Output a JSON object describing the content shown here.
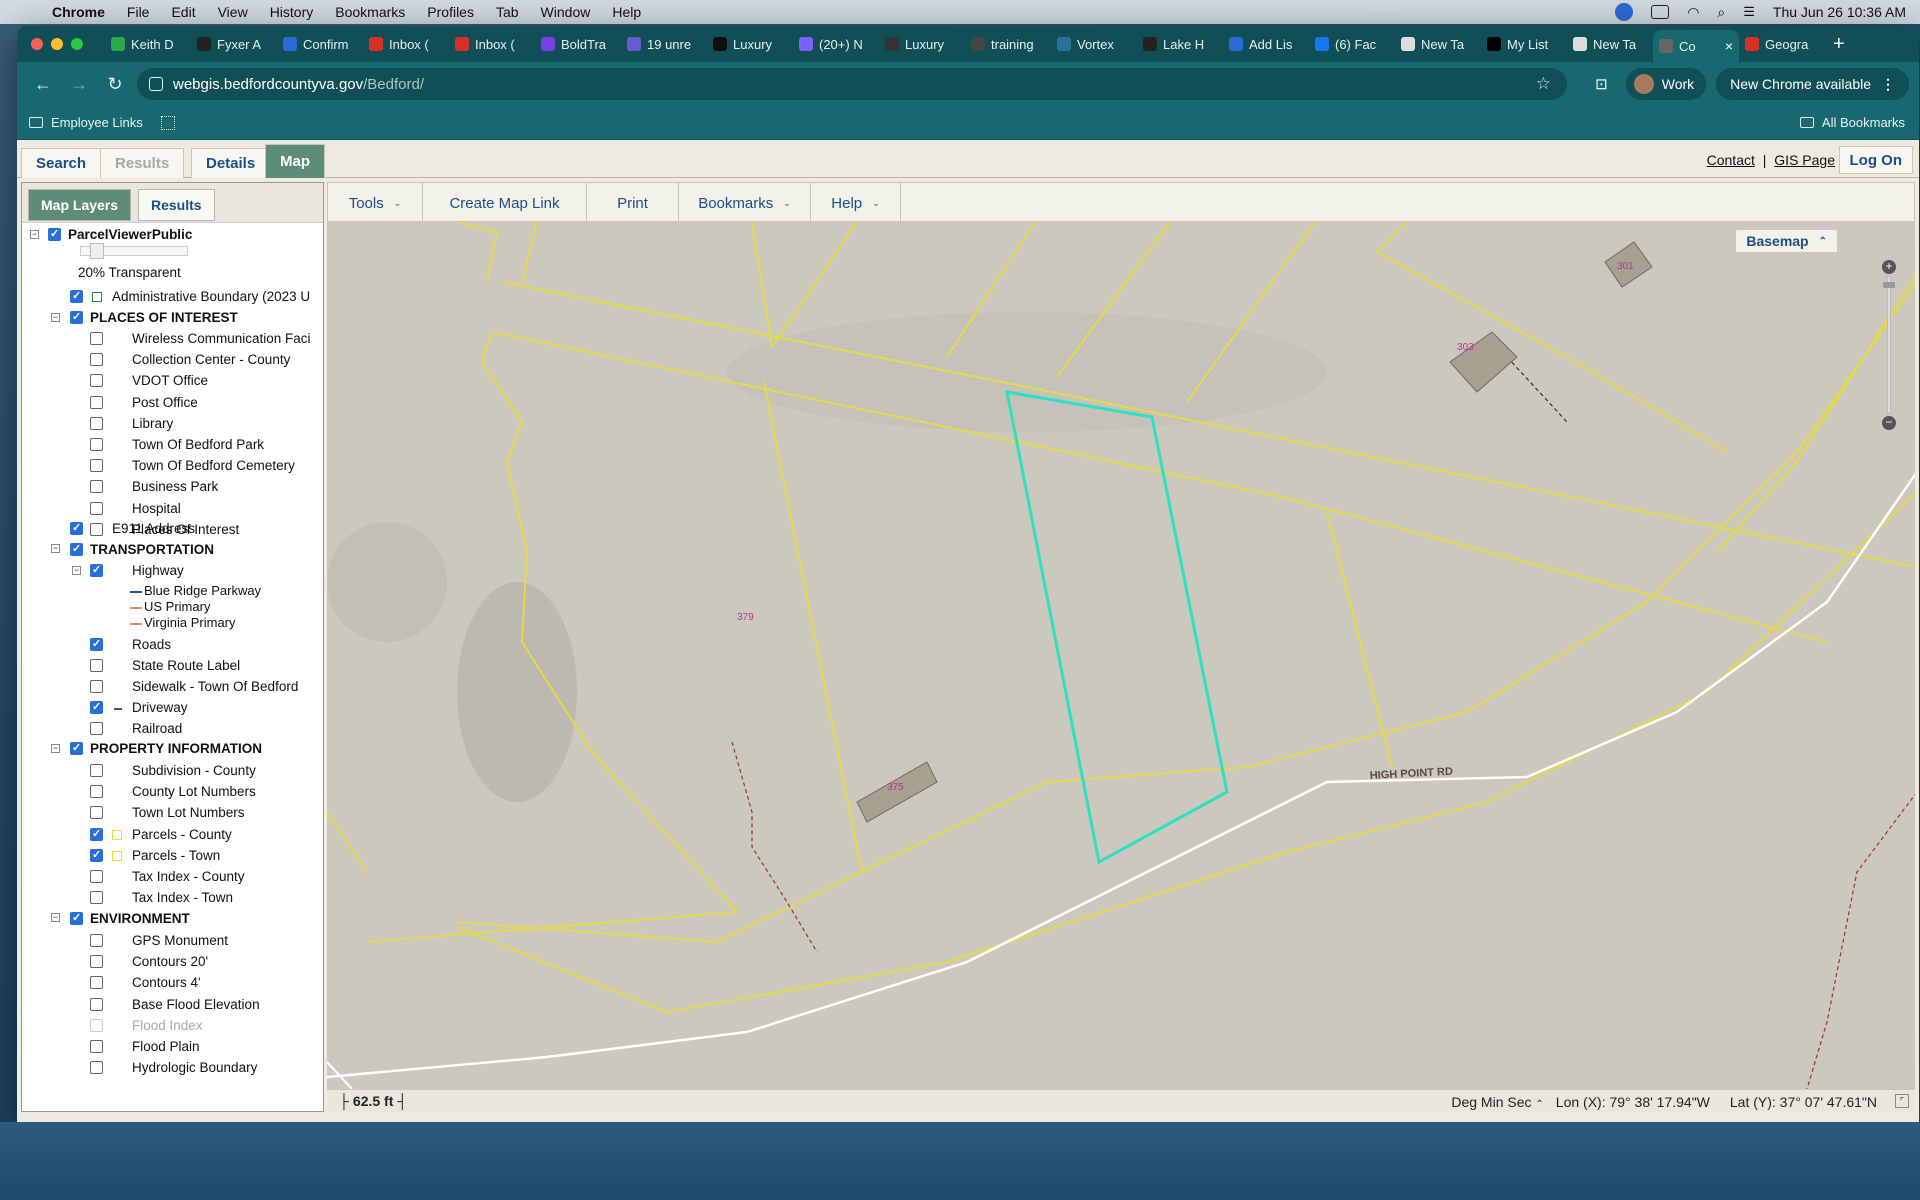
{
  "menubar": {
    "app": "Chrome",
    "items": [
      "File",
      "Edit",
      "View",
      "History",
      "Bookmarks",
      "Profiles",
      "Tab",
      "Window",
      "Help"
    ],
    "clock": "Thu Jun 26  10:36 AM"
  },
  "browser": {
    "tabs": [
      {
        "label": "Keith D",
        "color": "#2aa84a"
      },
      {
        "label": "Fyxer A",
        "color": "#222222"
      },
      {
        "label": "Confirm",
        "color": "#2b6bd6"
      },
      {
        "label": "Inbox (",
        "color": "#d93025"
      },
      {
        "label": "Inbox (",
        "color": "#d93025"
      },
      {
        "label": "BoldTra",
        "color": "#7b3fe4"
      },
      {
        "label": "19 unre",
        "color": "#6a5acd"
      },
      {
        "label": "Luxury",
        "color": "#111111"
      },
      {
        "label": "(20+) N",
        "color": "#7b61ff"
      },
      {
        "label": "Luxury",
        "color": "#333333"
      },
      {
        "label": "training",
        "color": "#444444"
      },
      {
        "label": "Vortex",
        "color": "#2b6f9a"
      },
      {
        "label": "Lake H",
        "color": "#222222"
      },
      {
        "label": "Add Lis",
        "color": "#2b6bd6"
      },
      {
        "label": "(6) Fac",
        "color": "#1877f2"
      },
      {
        "label": "New Ta",
        "color": "#dddddd"
      },
      {
        "label": "My List",
        "color": "#000000"
      },
      {
        "label": "New Ta",
        "color": "#dddddd"
      },
      {
        "label": "Co",
        "color": "#666666",
        "active": true
      },
      {
        "label": "Geogra",
        "color": "#d93025"
      }
    ],
    "url_host": "webgis.bedfordcountyva.gov",
    "url_path": "/Bedford/",
    "profile": "Work",
    "new_chrome": "New Chrome available",
    "bookmark_employee": "Employee Links",
    "bookmark_all": "All Bookmarks"
  },
  "page": {
    "tabs": {
      "search": "Search",
      "results": "Results",
      "details": "Details",
      "map": "Map"
    },
    "contact": "Contact",
    "separator": "|",
    "gis_page": "GIS Page",
    "log_on": "Log On",
    "subtabs": {
      "map_layers": "Map Layers",
      "results": "Results"
    }
  },
  "layers": {
    "root": "ParcelViewerPublic",
    "transparency": "20% Transparent",
    "transparency_value": 0.2,
    "admin_boundary": "Administrative Boundary (2023 U",
    "places": {
      "title": "PLACES OF INTEREST",
      "items": [
        "Wireless Communication Faci",
        "Collection Center - County",
        "VDOT Office",
        "Post Office",
        "Library",
        "Town Of Bedford Park",
        "Town Of Bedford Cemetery",
        "Business Park",
        "Hospital",
        "Places Of Interest"
      ]
    },
    "e911": "E911 Address",
    "transportation": {
      "title": "TRANSPORTATION",
      "highway": "Highway",
      "legend": [
        {
          "label": "Blue Ridge Parkway",
          "color": "#2a4f8a"
        },
        {
          "label": "US Primary",
          "color": "#e58a6a"
        },
        {
          "label": "Virginia Primary",
          "color": "#e58a6a"
        }
      ],
      "roads": "Roads",
      "state_route_label": "State Route Label",
      "sidewalk": "Sidewalk - Town Of Bedford",
      "driveway": "Driveway",
      "railroad": "Railroad"
    },
    "property": {
      "title": "PROPERTY INFORMATION",
      "items": [
        "Subdivision - County",
        "County Lot Numbers",
        "Town Lot Numbers",
        "Parcels - County",
        "Parcels - Town",
        "Tax Index - County",
        "Tax Index - Town"
      ]
    },
    "environment": {
      "title": "ENVIRONMENT",
      "items": [
        "GPS Monument",
        "Contours 20'",
        "Contours 4'",
        "Base Flood Elevation",
        "Flood Index",
        "Flood Plain",
        "Hydrologic Boundary"
      ]
    }
  },
  "map_toolbar": {
    "tools": "Tools",
    "create_link": "Create Map Link",
    "print": "Print",
    "bookmarks": "Bookmarks",
    "help": "Help"
  },
  "map": {
    "basemap": "Basemap",
    "road_label": "HIGH POINT RD",
    "addresses": {
      "a": "379",
      "b": "375",
      "c": "303",
      "d": "301"
    },
    "parcel_color": "#e6dc3c",
    "highlight_color": "#2fe0c0",
    "road_color": "#ffffff"
  },
  "status": {
    "scale": "62.5 ft",
    "units": "Deg Min Sec",
    "lon": "Lon (X): 79° 38' 17.94\"W",
    "lat": "Lat (Y): 37° 07' 47.61\"N"
  }
}
